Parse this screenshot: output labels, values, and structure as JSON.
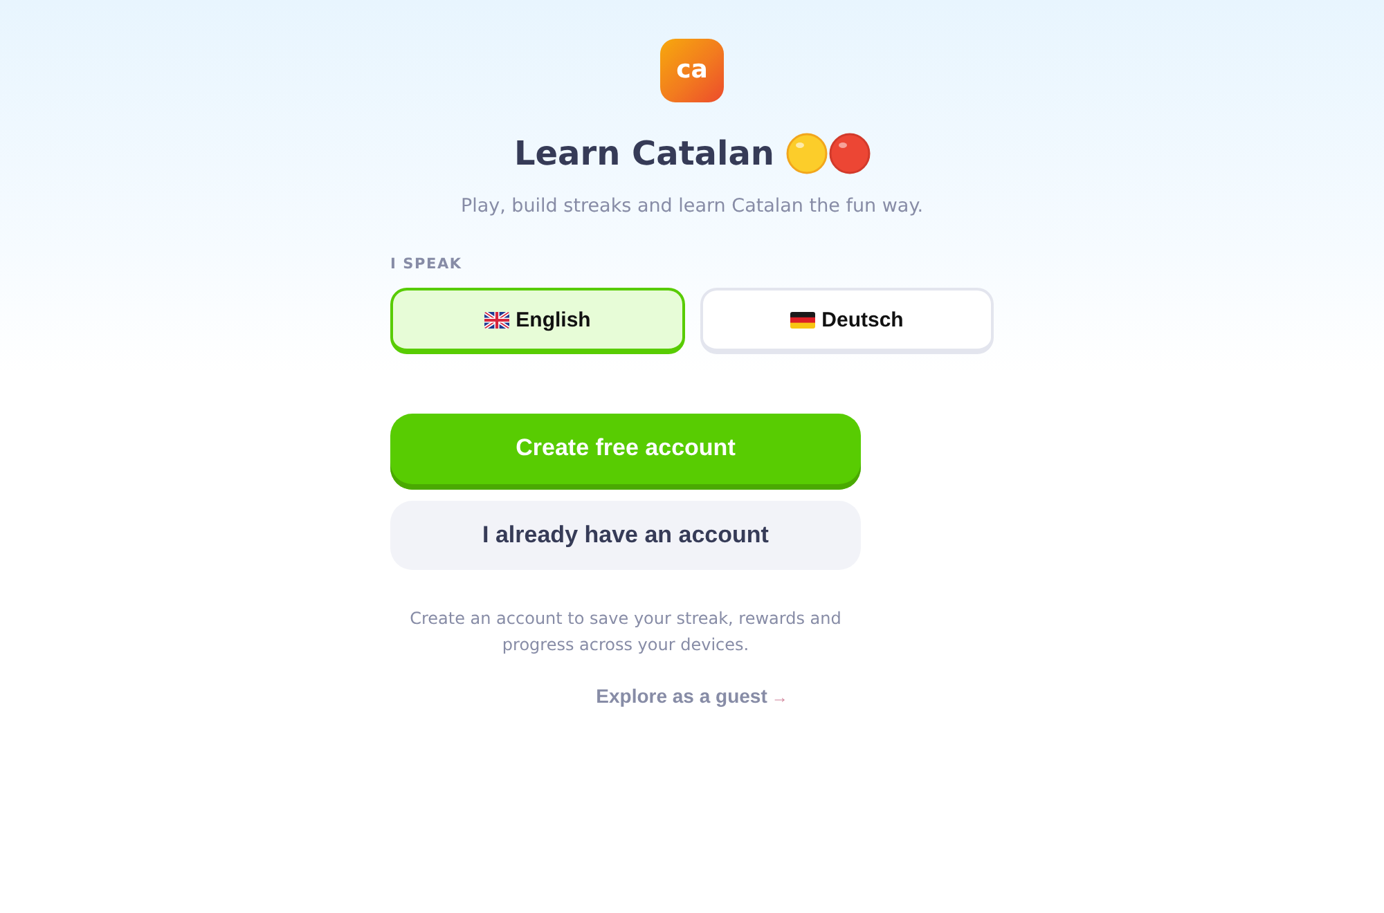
{
  "logo": {
    "text": "ca"
  },
  "title": "Learn Catalan",
  "subtitle": "Play, build streaks and learn Catalan the fun way.",
  "language_picker": {
    "label": "I SPEAK",
    "options": [
      {
        "label": "English",
        "kind": "uk",
        "selected": true
      },
      {
        "label": "Deutsch",
        "kind": "germany",
        "selected": false
      }
    ]
  },
  "buttons": [
    {
      "label": "Create free account",
      "kind": "primary"
    },
    {
      "label": "I already have an account",
      "kind": "secondary"
    }
  ],
  "note": "Create an account to save your streak, rewards and progress across your devices.",
  "guest_link": {
    "label": "Explore as a guest",
    "arrow": "→"
  }
}
